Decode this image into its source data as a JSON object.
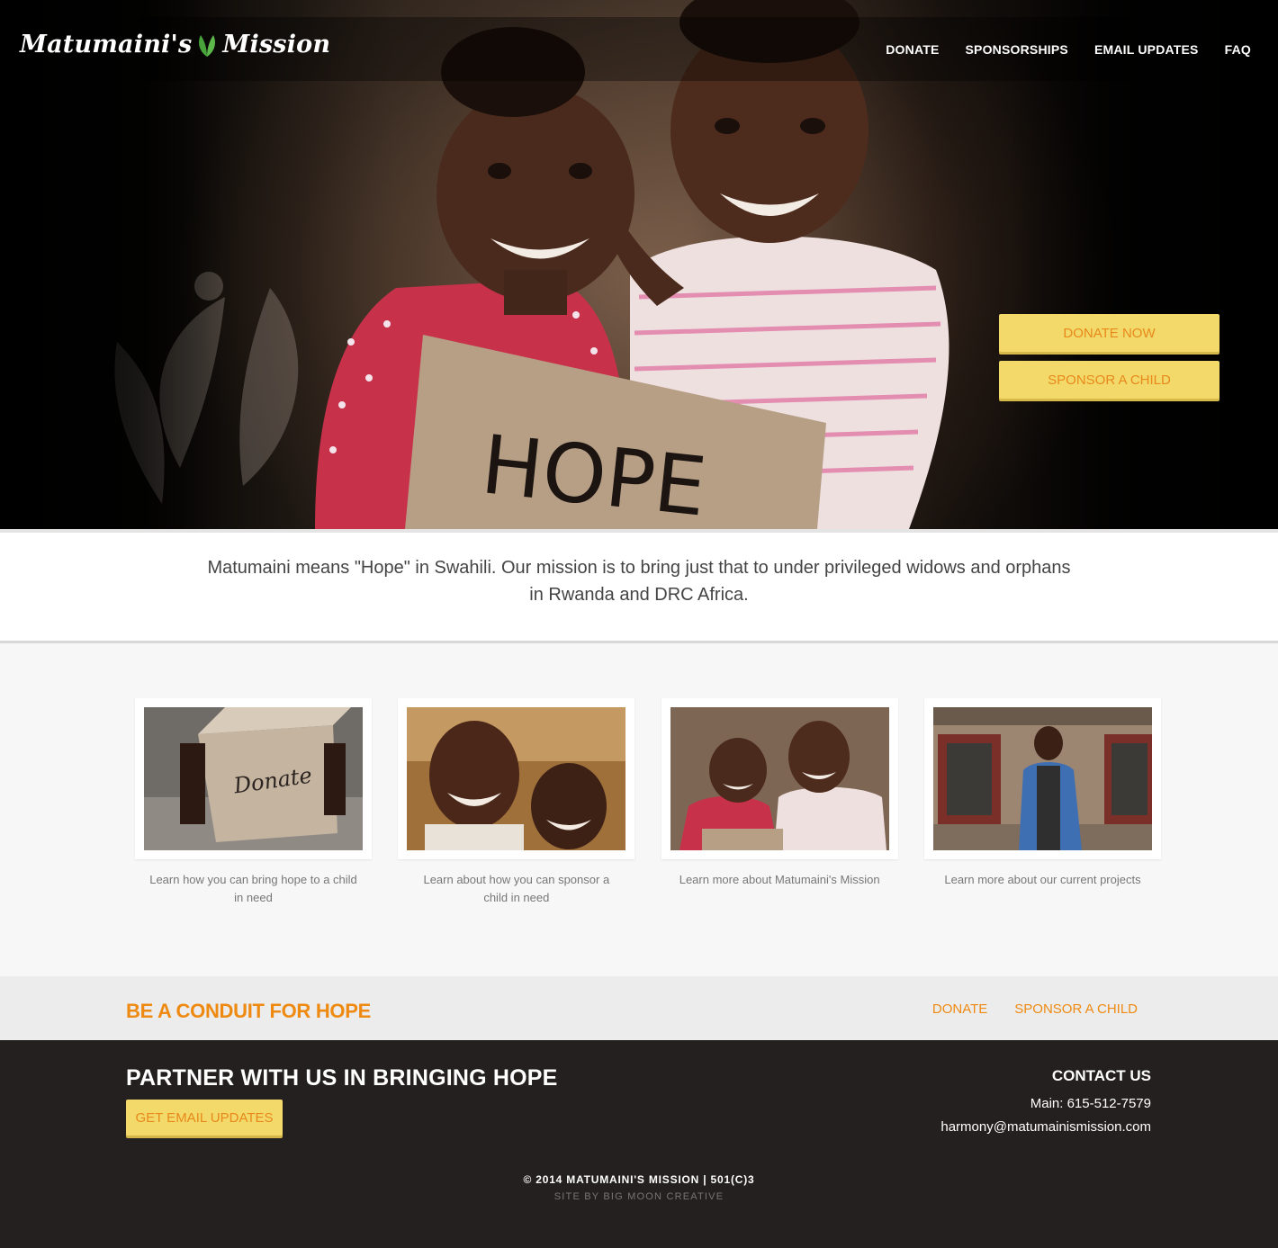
{
  "header": {
    "logo_part1": "Matumaini's",
    "logo_part2": "Mission",
    "nav": [
      "DONATE",
      "SPONSORSHIPS",
      "EMAIL UPDATES",
      "FAQ"
    ]
  },
  "hero": {
    "sign_text": "HOPE",
    "buttons": [
      "DONATE NOW",
      "SPONSOR A CHILD"
    ]
  },
  "mission": {
    "text": "Matumaini means \"Hope\" in Swahili. Our mission is to bring just that to under privileged widows and orphans in Rwanda and DRC Africa."
  },
  "cards": [
    {
      "caption": "Learn how you can bring hope to a child in need",
      "box_text": "Donate"
    },
    {
      "caption": "Learn about how you can sponsor a child in need"
    },
    {
      "caption": "Learn more about Matumaini's Mission"
    },
    {
      "caption": "Learn more about our current projects"
    }
  ],
  "conduit": {
    "heading": "BE A CONDUIT FOR HOPE",
    "links": [
      "DONATE",
      "SPONSOR A CHILD"
    ]
  },
  "footer": {
    "heading": "PARTNER WITH US IN BRINGING HOPE",
    "button": "GET EMAIL UPDATES",
    "contact_heading": "CONTACT US",
    "phone": "Main: 615-512-7579",
    "email": "harmony@matumainismission.com",
    "copyright": "© 2014 MATUMAINI'S MISSION | 501(C)3",
    "credit": "SITE BY BIG MOON CREATIVE"
  },
  "colors": {
    "accent_orange": "#ee8a12",
    "button_yellow": "#f2d96a",
    "footer_bg": "#24201f"
  }
}
